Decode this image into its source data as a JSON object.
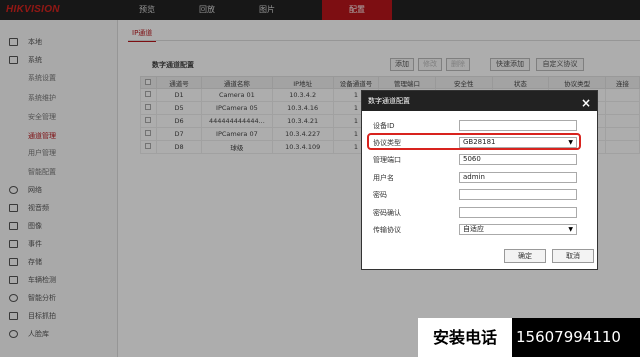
{
  "brand": "HIKVISION",
  "nav": [
    "预览",
    "回放",
    "图片",
    "配置"
  ],
  "sidebar": {
    "items": [
      {
        "label": "本地"
      },
      {
        "label": "系统"
      },
      {
        "label": "系统设置"
      },
      {
        "label": "系统维护"
      },
      {
        "label": "安全管理"
      },
      {
        "label": "通道管理"
      },
      {
        "label": "用户管理"
      },
      {
        "label": "智能配置"
      },
      {
        "label": "网络"
      },
      {
        "label": "视音频"
      },
      {
        "label": "图像"
      },
      {
        "label": "事件"
      },
      {
        "label": "存储"
      },
      {
        "label": "车辆检测"
      },
      {
        "label": "智能分析"
      },
      {
        "label": "目标抓拍"
      },
      {
        "label": "人脸库"
      }
    ]
  },
  "tab": "IP通道",
  "panel_title": "数字通道配置",
  "buttons": {
    "add": "添加",
    "modify": "修改",
    "delete": "删除",
    "quick_add": "快速添加",
    "custom_protocol": "自定义协议"
  },
  "table": {
    "headers": [
      "",
      "通道号",
      "通道名称",
      "IP地址",
      "设备通道号",
      "管理端口",
      "安全性",
      "状态",
      "协议类型",
      "连接"
    ],
    "rows": [
      [
        "",
        "D1",
        "Camera 01",
        "10.3.4.2",
        "1",
        "",
        "",
        "",
        "",
        ""
      ],
      [
        "",
        "D5",
        "IPCamera 05",
        "10.3.4.16",
        "1",
        "",
        "",
        "",
        "",
        ""
      ],
      [
        "",
        "D6",
        "444444444444...",
        "10.3.4.21",
        "1",
        "",
        "",
        "",
        "",
        ""
      ],
      [
        "",
        "D7",
        "IPCamera 07",
        "10.3.4.227",
        "1",
        "",
        "",
        "",
        "",
        ""
      ],
      [
        "",
        "D8",
        "球级",
        "10.3.4.109",
        "1",
        "",
        "",
        "",
        "",
        ""
      ]
    ]
  },
  "dialog": {
    "title": "数字通道配置",
    "close": "×",
    "device_id_label": "设备ID",
    "device_id": "",
    "protocol_label": "协议类型",
    "protocol": "GB28181",
    "port_label": "管理端口",
    "port": "5060",
    "user_label": "用户名",
    "user": "admin",
    "password_label": "密码",
    "password": "",
    "confirm_label": "密码确认",
    "confirm": "",
    "transport_label": "传输协议",
    "transport": "自适应",
    "ok": "确定",
    "cancel": "取消"
  },
  "ad": {
    "left": "安装电话",
    "right": "15607994110"
  },
  "colors": {
    "accent": "#b9161b",
    "topbar": "#232323",
    "highlight": "#d8231e"
  }
}
